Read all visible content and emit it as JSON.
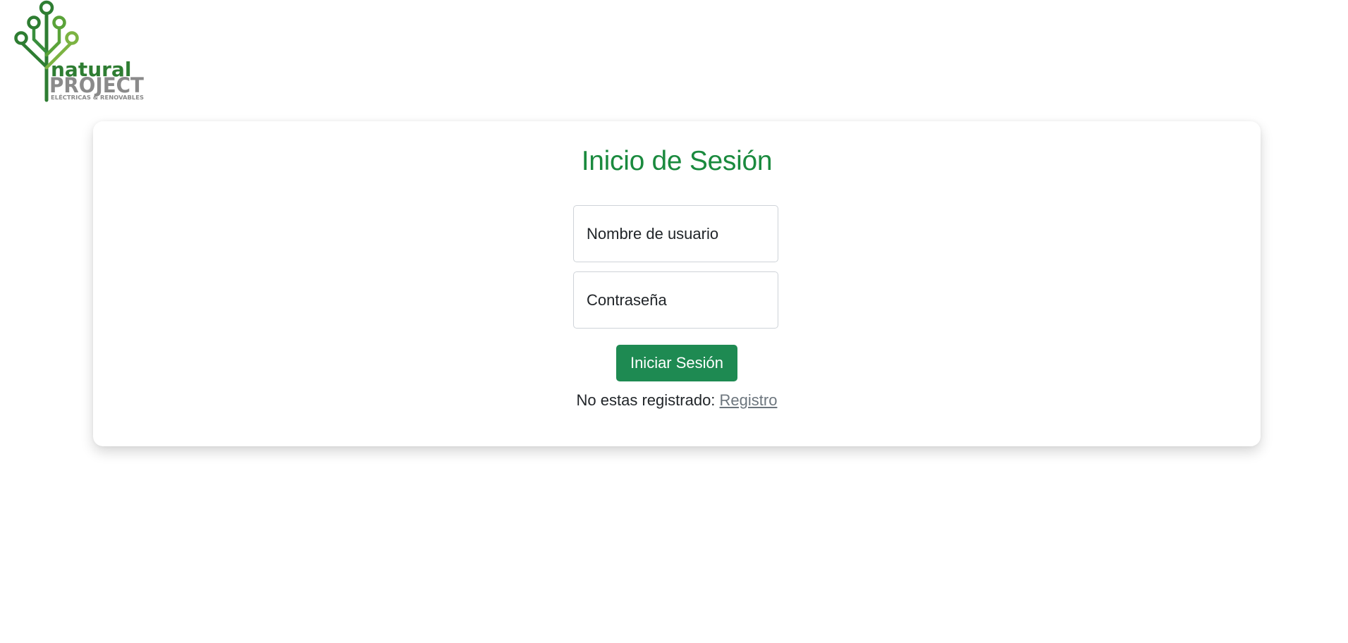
{
  "logo": {
    "word_top": "natural",
    "word_main": "PROJECT",
    "tagline": "ELÉCTRICAS & RENOVABLES",
    "colors": {
      "dark_green": "#2e7d32",
      "light_green": "#7cb342",
      "gray": "#888888"
    }
  },
  "login": {
    "title": "Inicio de Sesión",
    "username_placeholder": "Nombre de usuario",
    "password_placeholder": "Contraseña",
    "submit_label": "Iniciar Sesión",
    "register_prompt": "No estas registrado:",
    "register_link": "Registro"
  },
  "colors": {
    "title_green": "#1a8a3e",
    "button_green": "#1e8a52",
    "link_gray": "#6c757d"
  }
}
